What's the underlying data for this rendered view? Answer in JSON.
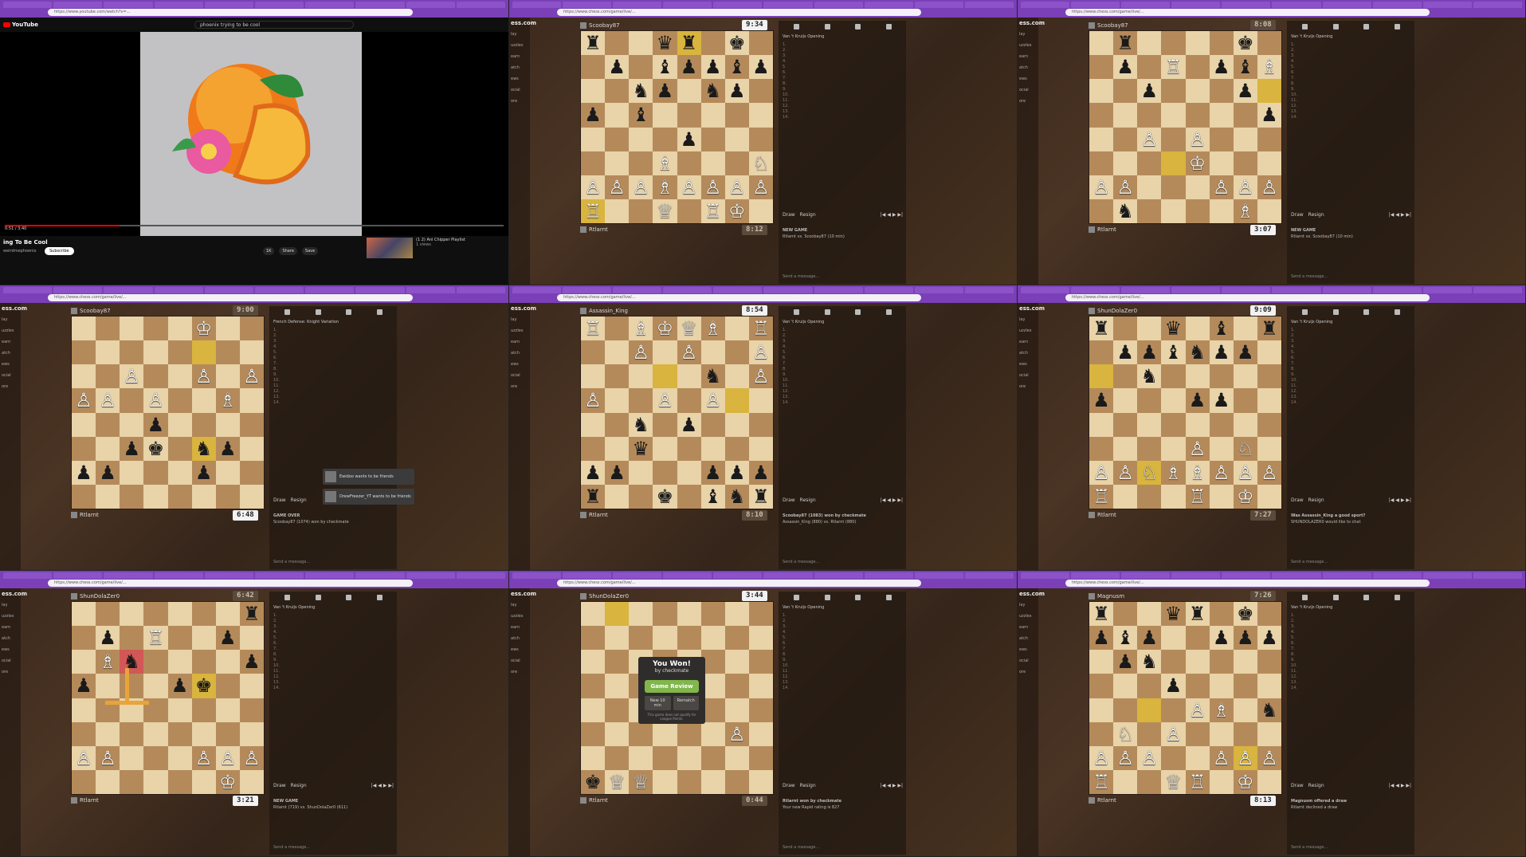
{
  "panels": [
    {
      "type": "youtube",
      "tabs": [],
      "url": "https://www.youtube.com/watch?v=...",
      "search": "phoenix trying to be cool",
      "logo": "YouTube",
      "video_title": "ing To Be Cool",
      "channel": "weirdmephoenix",
      "subscribe": "Subscribe",
      "time": "0:51 / 3:40",
      "progress": 0.23,
      "likes": "1K",
      "share": "Share",
      "save": "Save",
      "rec_title": "(1 2) Ani Chipper Playlist",
      "rec_meta": "1 views"
    },
    {
      "type": "chess",
      "url": "https://www.chess.com/game/live/...",
      "top_name": "Scoobay87",
      "bot_name": "Rtlarnt",
      "top_clock": "9:34",
      "bot_clock": "8:12",
      "opening": "Van 't Kruijs Opening",
      "draw": "Draw",
      "resign": "Resign",
      "msg1": "NEW GAME",
      "msg2": "Rtlarnt vs. Scoobay87 (10 min)",
      "send": "Send a message...",
      "fen": "r2qr1k1/1p1bppbp/2np1np1/p1b5/4p3/3B3N/PPPBPPPP/R2Q1RK1"
    },
    {
      "type": "chess",
      "url": "https://www.chess.com/game/live/...",
      "top_name": "Scoobay87",
      "bot_name": "Rtlarnt",
      "top_clock": "8:08",
      "bot_clock": "3:07",
      "opening": "Van 't Kruijs Opening",
      "draw": "Draw",
      "resign": "Resign",
      "msg1": "NEW GAME",
      "msg2": "Rtlarnt vs. Scoobay87 (10 min)",
      "send": "Send a message...",
      "fen": "1r4k1/1p1R1pbB/2p3p1/7p/2P1P3/4K3/PP3PPP/1n4B1"
    },
    {
      "type": "chess",
      "url": "https://www.chess.com/game/live/...",
      "top_name": "Scoobay87",
      "bot_name": "Rtlarnt",
      "top_clock": "9:00",
      "bot_clock": "6:48",
      "opening": "French Defense: Knight Variation",
      "draw": "Draw",
      "resign": "Resign",
      "msg1": "GAME OVER",
      "msg2": "Scoobay87 (1074) won by checkmate",
      "send": "Send a message...",
      "toast1": "Ewidoo wants to be friends",
      "toast2": "DrewFreezer_YT wants to be friends",
      "fen": "5K2/8/2P2P1P/PP1P2B1/3p4/2pk1np1/pp3p2/8",
      "ranks_flipped": true
    },
    {
      "type": "chess",
      "url": "https://www.chess.com/game/live/...",
      "top_name": "Assassin_King",
      "bot_name": "Rtlarnt",
      "top_clock": "8:54",
      "bot_clock": "8:10",
      "opening": "Van 't Kruijs Opening",
      "draw": "Draw",
      "resign": "Resign",
      "msg1": "Scoobay87 (1083) won by checkmate",
      "msg2": "Assassin_King (880) vs. Rtlarnt (880)",
      "send": "Send a message...",
      "fen": "R1BKQB1R/2P1P2P/5n1P/P2P1P2/2n1p3/2q5/pp3ppp/r2k1bnr"
    },
    {
      "type": "chess",
      "url": "https://www.chess.com/game/live/...",
      "top_name": "ShunDolaZer0",
      "bot_name": "Rtlarnt",
      "top_clock": "9:09",
      "bot_clock": "7:27",
      "opening": "Van 't Kruijs Opening",
      "draw": "Draw",
      "resign": "Resign",
      "msg1": "Was Assassin_King a good sport?",
      "msg2": "SHUNDOLAZER0 would like to chat",
      "send": "Send a message...",
      "fen": "r2q1b1r/1ppbnpp1/2n5/p3pp2/8/4P1N1/PPNBBPPP/R3R1K1"
    },
    {
      "type": "chess",
      "url": "https://www.chess.com/game/live/...",
      "top_name": "ShunDolaZer0",
      "bot_name": "Rtlarnt",
      "top_clock": "6:42",
      "bot_clock": "3:21",
      "opening": "Van 't Kruijs Opening",
      "draw": "Draw",
      "resign": "Resign",
      "msg1": "NEW GAME",
      "msg2": "Rtlarnt (719) vs. ShunDolaZer0 (611)",
      "send": "Send a message...",
      "fen": "7r/1p1R2p1/1Bn4p/p3pk2/8/8/PP3PPP/6K1"
    },
    {
      "type": "chess",
      "url": "https://www.chess.com/game/live/...",
      "top_name": "ShunDolaZer0",
      "bot_name": "Rtlarnt",
      "top_clock": "3:44",
      "bot_clock": "0:44",
      "opening": "Van 't Kruijs Opening",
      "draw": "Draw",
      "resign": "Resign",
      "msg1": "Rtlarnt won by checkmate",
      "msg2": "Your new Rapid rating is 827",
      "send": "Send a message...",
      "popup_title": "You Won!",
      "popup_sub": "by checkmate",
      "popup_review": "Game Review",
      "popup_new": "New 10 min",
      "popup_rematch": "Rematch",
      "popup_note": "This game does not qualify for League Points.",
      "fen": "8/8/8/8/8/6P1/8/kQQ5"
    },
    {
      "type": "chess",
      "url": "https://www.chess.com/game/live/...",
      "top_name": "Magnusm",
      "bot_name": "Rtlarnt",
      "top_clock": "7:26",
      "bot_clock": "8:13",
      "opening": "Van 't Kruijs Opening",
      "draw": "Draw",
      "resign": "Resign",
      "msg1": "Magnusm offered a draw",
      "msg2": "Rtlarnt declined a draw",
      "send": "Send a message...",
      "fen": "r2qr1k1/pbp2ppp/1pn5/3p4/4PB1n/1N1P4/PPP2PPP/R2QR1K1"
    }
  ],
  "colors": {
    "light_square": "#e9d3a8",
    "dark_square": "#b58a5a",
    "highlight": "#d9b43e",
    "chrome": "#7b3fb8",
    "review_green": "#81b64c"
  }
}
